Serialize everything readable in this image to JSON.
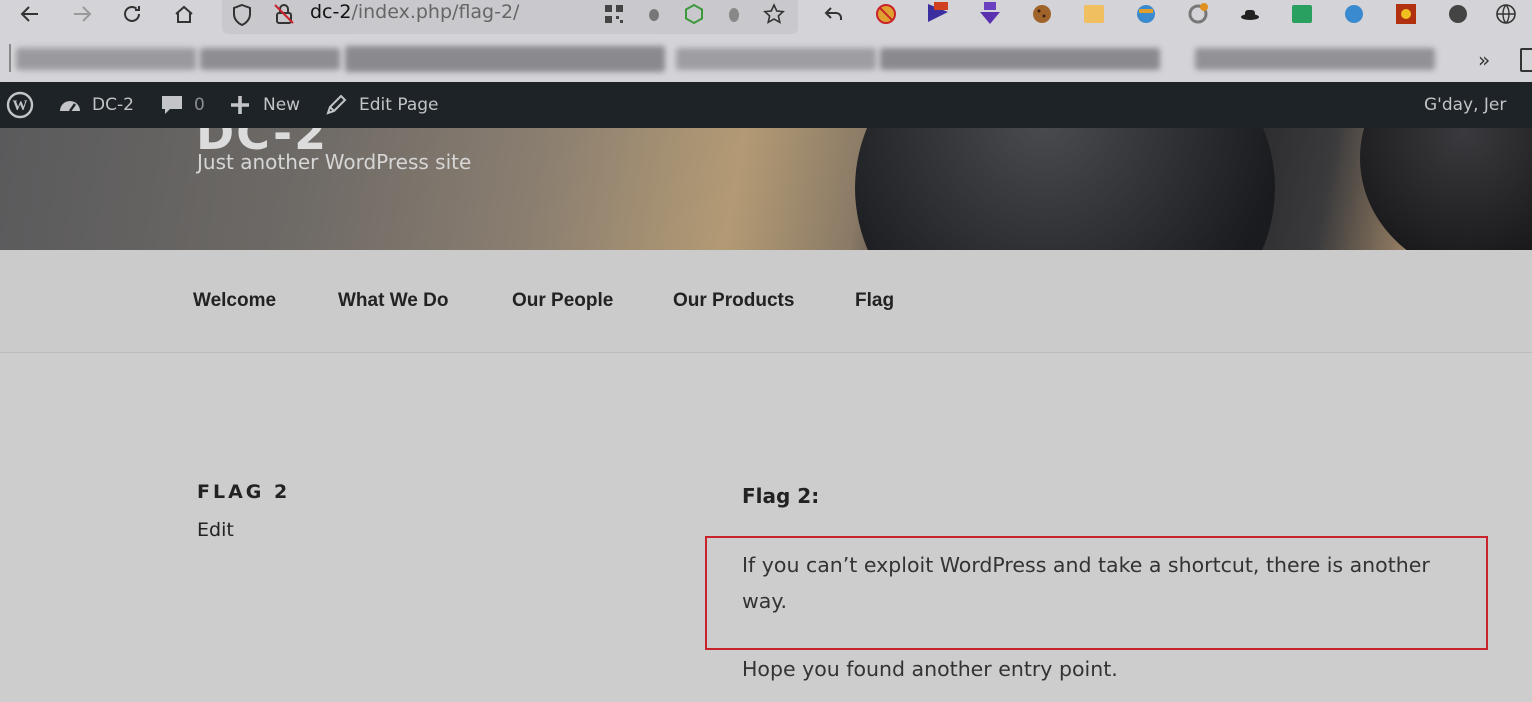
{
  "browser": {
    "url_host": "dc-2",
    "url_path": "/index.php/flag-2/"
  },
  "admin_bar": {
    "site_name": "DC-2",
    "comments_count": "0",
    "new_label": "New",
    "edit_page_label": "Edit Page",
    "greeting": "G'day, Jer"
  },
  "header": {
    "tagline": "Just another WordPress site"
  },
  "menu": {
    "items": [
      "Welcome",
      "What We Do",
      "Our People",
      "Our Products",
      "Flag"
    ]
  },
  "page": {
    "title": "FLAG 2",
    "edit_link": "Edit",
    "heading": "Flag 2:",
    "paragraph_1": "If you can’t exploit WordPress and take a shortcut, there is another way.",
    "paragraph_2": "Hope you found another entry point."
  },
  "colors": {
    "highlight_box": "#c8222a",
    "admin_bar_bg": "#1d2327"
  }
}
